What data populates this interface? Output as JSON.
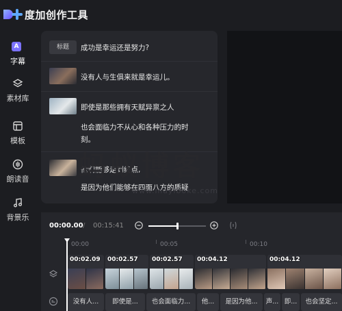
{
  "app": {
    "title": "度加创作工具"
  },
  "sidebar": {
    "items": [
      {
        "label": "字幕",
        "icon": "subtitle-icon",
        "active": true,
        "glyph": "A"
      },
      {
        "label": "素材库",
        "icon": "layers-icon",
        "active": false
      },
      {
        "label": "模板",
        "icon": "template-icon",
        "active": false
      },
      {
        "label": "朗读音",
        "icon": "voice-icon",
        "active": false
      },
      {
        "label": "背景乐",
        "icon": "music-icon",
        "active": false
      }
    ]
  },
  "subtitles": {
    "title_tag": "标题",
    "title_text": "成功是幸运还是努力?",
    "rows": [
      {
        "lines": [
          "没有人与生俱来就是幸运儿。"
        ]
      },
      {
        "lines": [
          "即使是那些拥有天赋异禀之人",
          "也会面临力不从心和各种压力的时",
          "刻。"
        ]
      },
      {
        "lines": [
          "他们能够走到终点,",
          "是因为他们能够在四面八方的质疑"
        ]
      }
    ]
  },
  "watermark": {
    "main": "蚂蚁博客",
    "sub": "www.mayiboke.com"
  },
  "timeline": {
    "current_time": "00:00.00",
    "separator": "/",
    "total_time": "00:15:41",
    "zoom_level": 0.5,
    "ruler_labels": [
      "00:00",
      "00:05",
      "00:10"
    ],
    "video_clips": [
      {
        "duration": "00:02.09"
      },
      {
        "duration": "00:02.57"
      },
      {
        "duration": "00:02.57"
      },
      {
        "duration": "00:04.12"
      },
      {
        "duration": "00:04.12"
      }
    ],
    "subtitle_clips": [
      "没有人...",
      "即使是...",
      "也会面临力...",
      "他...",
      "是因为他...",
      "声...",
      "即...",
      "也会坚定..."
    ]
  },
  "colors": {
    "accent": "#7b72ff",
    "background": "#1c1d21",
    "panel": "#26272c"
  }
}
